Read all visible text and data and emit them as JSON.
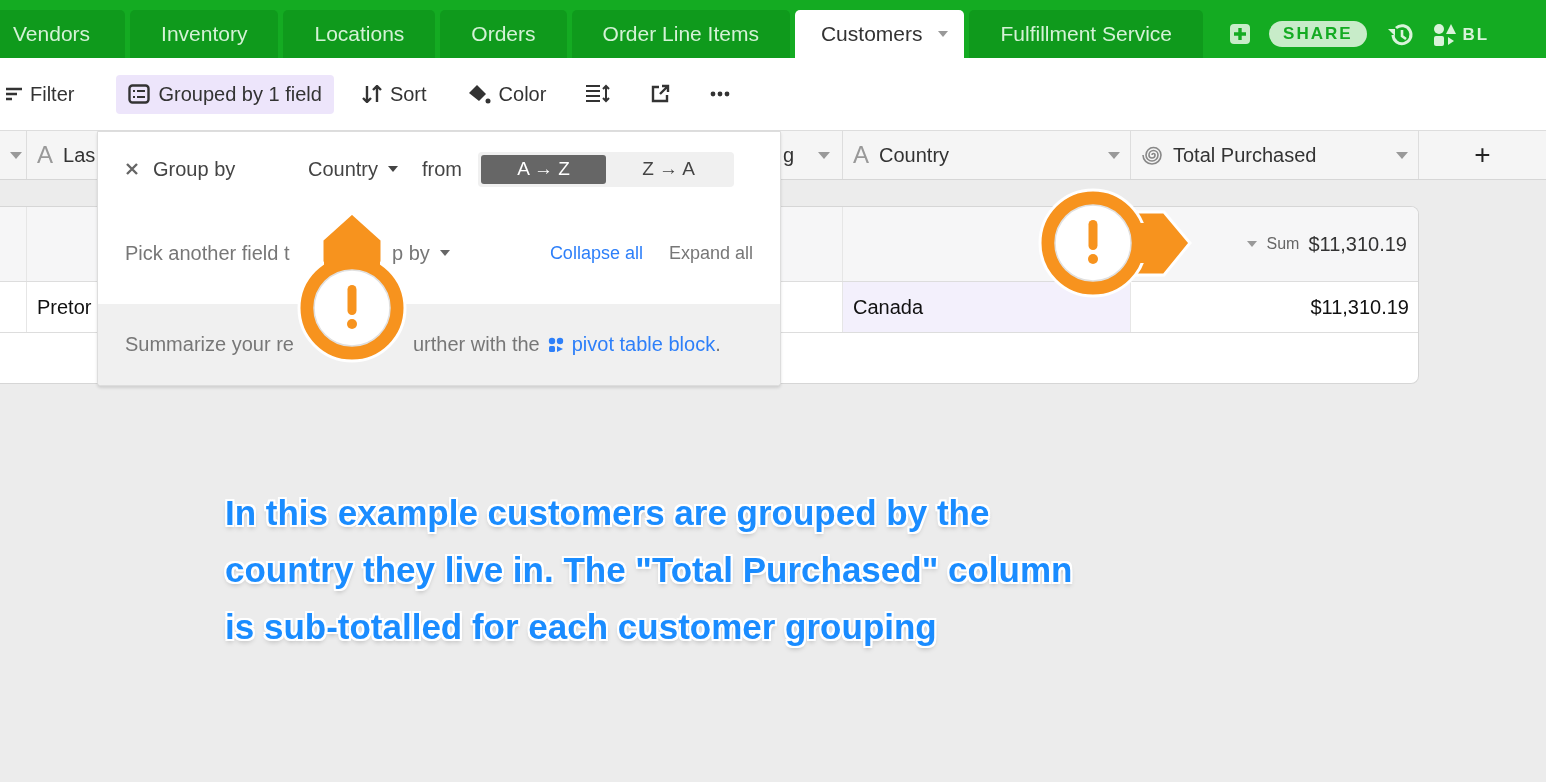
{
  "tabs": [
    {
      "label": "Vendors",
      "selected": false
    },
    {
      "label": "Inventory",
      "selected": false
    },
    {
      "label": "Locations",
      "selected": false
    },
    {
      "label": "Orders",
      "selected": false
    },
    {
      "label": "Order Line Items",
      "selected": false
    },
    {
      "label": "Customers",
      "selected": true
    },
    {
      "label": "Fulfillment Service",
      "selected": false
    }
  ],
  "header_actions": {
    "share": "SHARE",
    "blocks": "BL"
  },
  "toolbar": [
    {
      "kind": "filter",
      "label": "Filter",
      "active": false
    },
    {
      "kind": "group",
      "label": "Grouped by 1 field",
      "active": true
    },
    {
      "kind": "sort",
      "label": "Sort",
      "active": false
    },
    {
      "kind": "color",
      "label": "Color",
      "active": false
    },
    {
      "kind": "row-height",
      "active": false
    },
    {
      "kind": "share",
      "active": false
    },
    {
      "kind": "more",
      "active": false
    }
  ],
  "columns": [
    {
      "kind": "plain"
    },
    {
      "kind": "text",
      "glyph": "A",
      "label": "Las"
    },
    {
      "kind": "plain",
      "label": "g"
    },
    {
      "kind": "text",
      "glyph": "A",
      "label": "Country"
    },
    {
      "kind": "rollup",
      "label": "Total Purchased"
    }
  ],
  "add_column": "+",
  "group": {
    "summary_label": "Sum",
    "summary_value": "$11,310.19"
  },
  "rows": [
    {
      "cells": [
        "",
        "Pretor",
        "",
        "Canada",
        "$11,310.19"
      ]
    }
  ],
  "popover": {
    "title": "Group by",
    "field": "Country",
    "from": "from",
    "sort_options": [
      {
        "label": "A → Z",
        "selected": true
      },
      {
        "label": "Z → A",
        "selected": false
      }
    ],
    "pick_parts": [
      "Pick another field t",
      "p by"
    ],
    "collapse": "Collapse all",
    "expand": "Expand all",
    "footer_parts": [
      "Summarize your re",
      "urther with the"
    ],
    "footer_link": "pivot table block",
    "footer_end": "."
  },
  "markers": [
    {
      "kind": "up"
    },
    {
      "kind": "right"
    }
  ],
  "annotation_lines": [
    "In this example customers are grouped by the",
    "country they live in. The \"Total Purchased\" column",
    "is sub-totalled for each customer grouping"
  ]
}
